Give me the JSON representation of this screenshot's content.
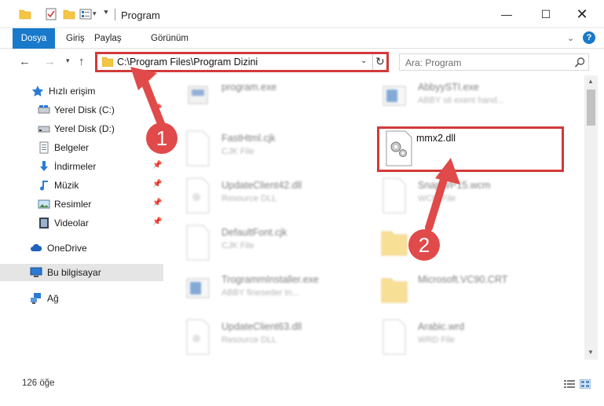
{
  "window": {
    "title": "Program",
    "min": "—",
    "max": "☐",
    "close": "✕"
  },
  "ribbon": {
    "tabs": [
      "Dosya",
      "Giriş",
      "Paylaş",
      "Görünüm"
    ]
  },
  "nav": {
    "address": "C:\\Program Files\\Program Dizini",
    "search_placeholder": "Ara: Program"
  },
  "sidebar": {
    "items": [
      {
        "label": "Hızlı erişim",
        "icon": "star-icon"
      },
      {
        "label": "Yerel Disk (C:)",
        "icon": "drive-icon",
        "pinned": true
      },
      {
        "label": "Yerel Disk (D:)",
        "icon": "drive-icon",
        "pinned": true
      },
      {
        "label": "Belgeler",
        "icon": "documents-icon",
        "pinned": true
      },
      {
        "label": "İndirmeler",
        "icon": "download-icon",
        "pinned": true
      },
      {
        "label": "Müzik",
        "icon": "music-icon",
        "pinned": true
      },
      {
        "label": "Resimler",
        "icon": "pictures-icon",
        "pinned": true
      },
      {
        "label": "Videolar",
        "icon": "videos-icon",
        "pinned": true
      },
      {
        "label": "OneDrive",
        "icon": "cloud-icon"
      },
      {
        "label": "Bu bilgisayar",
        "icon": "computer-icon",
        "selected": true
      },
      {
        "label": "Ağ",
        "icon": "network-icon"
      }
    ]
  },
  "files": [
    {
      "name": "program.exe",
      "type": "",
      "icon": "exe-icon"
    },
    {
      "name": "AbbyySTI.exe",
      "type": "ABBY sti exent hand...",
      "icon": "app-icon"
    },
    {
      "name": "FastHtml.cjk",
      "type": "CJK File",
      "icon": "file-icon"
    },
    {
      "name": "mmx2.dll",
      "type": "",
      "icon": "dll-gear-icon",
      "selected": true
    },
    {
      "name": "UpdateClient42.dll",
      "type": "Resource DLL",
      "icon": "dll-icon"
    },
    {
      "name": "SnapWP15.wcm",
      "type": "WCM File",
      "icon": "file-icon"
    },
    {
      "name": "DefaultFont.cjk",
      "type": "CJK File",
      "icon": "file-icon"
    },
    {
      "name": "",
      "type": "",
      "icon": "folder-icon"
    },
    {
      "name": "TrogrammInstaller.exe",
      "type": "ABBY fineseder tn...",
      "icon": "app-icon"
    },
    {
      "name": "Microsoft.VC90.CRT",
      "type": "",
      "icon": "folder-icon"
    },
    {
      "name": "UpdateClient63.dll",
      "type": "Resource DLL",
      "icon": "dll-icon"
    },
    {
      "name": "Arabic.wrd",
      "type": "WRD File",
      "icon": "file-icon"
    }
  ],
  "status": {
    "item_count": "126 öğe"
  },
  "annotations": {
    "step1": "1",
    "step2": "2",
    "color": "#e04a4a"
  }
}
